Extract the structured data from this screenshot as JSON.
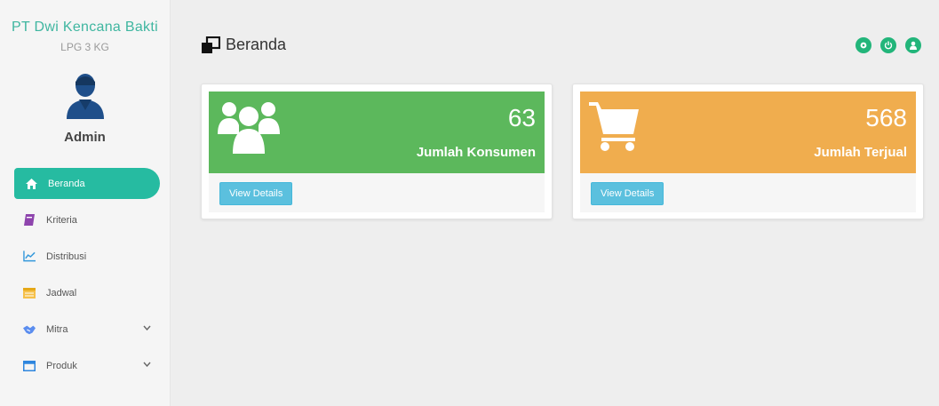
{
  "colors": {
    "accent": "#26bba1",
    "green_card": "#5cb85c",
    "orange_card": "#f0ad4e",
    "details_button": "#5bc0de",
    "action_button": "#22b57a"
  },
  "sidebar": {
    "brand": "PT Dwi Kencana Bakti",
    "subtitle": "LPG 3 KG",
    "profile_name": "Admin",
    "items": [
      {
        "label": "Beranda",
        "icon": "home-icon",
        "active": true
      },
      {
        "label": "Kriteria",
        "icon": "book-icon"
      },
      {
        "label": "Distribusi",
        "icon": "line-chart-icon"
      },
      {
        "label": "Jadwal",
        "icon": "calendar-icon"
      },
      {
        "label": "Mitra",
        "icon": "handshake-icon",
        "has_submenu": true
      },
      {
        "label": "Produk",
        "icon": "window-icon",
        "has_submenu": true
      }
    ]
  },
  "header": {
    "title": "Beranda",
    "title_icon": "clone-icon",
    "actions": [
      "settings-icon",
      "power-icon",
      "user-icon"
    ]
  },
  "cards": [
    {
      "value": "63",
      "label": "Jumlah Konsumen",
      "icon": "users-icon",
      "button": "View Details"
    },
    {
      "value": "568",
      "label": "Jumlah Terjual",
      "icon": "cart-icon",
      "button": "View Details"
    }
  ]
}
